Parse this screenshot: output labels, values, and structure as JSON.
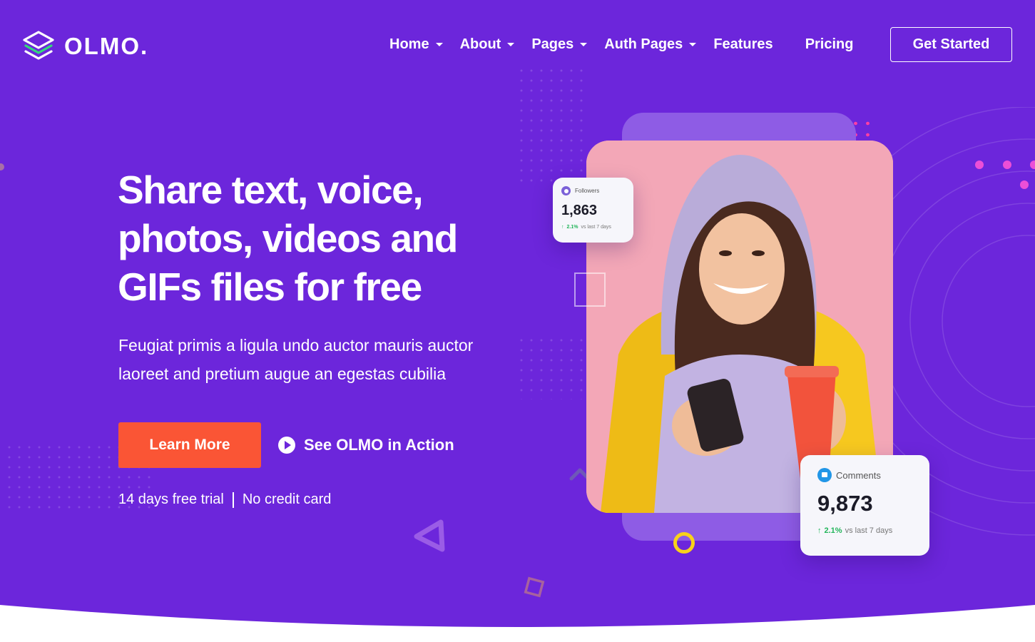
{
  "brand": {
    "name": "OLMO.",
    "logo_icon": "layers-icon"
  },
  "nav": {
    "items": [
      {
        "label": "Home",
        "has_dropdown": true
      },
      {
        "label": "About",
        "has_dropdown": true
      },
      {
        "label": "Pages",
        "has_dropdown": true
      },
      {
        "label": "Auth Pages",
        "has_dropdown": true
      },
      {
        "label": "Features",
        "has_dropdown": false
      },
      {
        "label": "Pricing",
        "has_dropdown": false
      }
    ],
    "cta_label": "Get Started"
  },
  "hero": {
    "headline_lines": [
      "Share text, voice,",
      "photos, videos and",
      "GIFs files for free"
    ],
    "subtext_lines": [
      "Feugiat primis a ligula undo auctor mauris auctor",
      "laoreet and pretium augue an egestas cubilia"
    ],
    "primary_button": "Learn More",
    "secondary_link": "See OLMO in Action",
    "trial_note": "14 days free trial",
    "card_note": "No credit card"
  },
  "stats": {
    "followers": {
      "title": "Followers",
      "value": "1,863",
      "change": "2.1%",
      "period": "vs last 7 days"
    },
    "comments": {
      "title": "Comments",
      "value": "9,873",
      "change": "2.1%",
      "period": "vs last 7 days"
    }
  },
  "colors": {
    "background": "#6c26db",
    "primary_button": "#fa5535",
    "back_card": "#8e5ce5",
    "photo_bg": "#f3a7b7",
    "positive": "#22b55a",
    "accent_yellow": "#f8d21a",
    "accent_pink": "#ff3fa4"
  }
}
